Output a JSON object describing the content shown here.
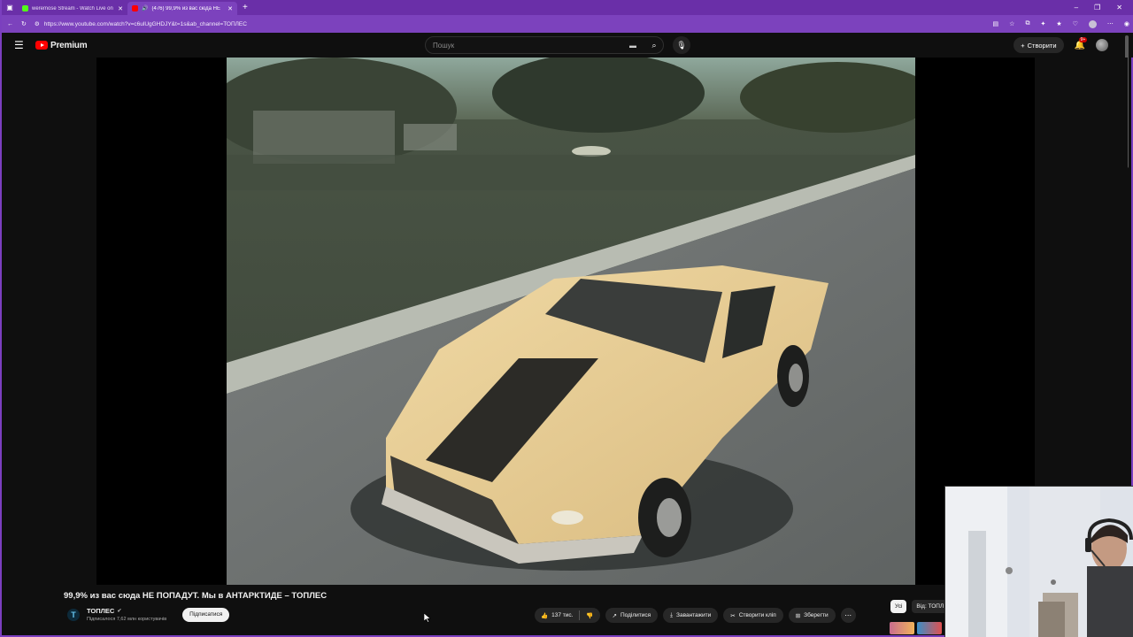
{
  "browser": {
    "tabs": [
      {
        "title": "weremose Stream - Watch Live on",
        "favicon_color": "#53fc18",
        "active": false
      },
      {
        "title": "(476) 99,9% из вас сюда НЕ",
        "favicon_color": "#ff0000",
        "active": true
      }
    ],
    "url": "https://www.youtube.com/watch?v=c6ulUgGHDJY&t=1s&ab_channel=ТОПЛЕС"
  },
  "youtube": {
    "logo_text": "Premium",
    "search_placeholder": "Пошук",
    "create_label": "Створити",
    "notifications_badge": "9+"
  },
  "video": {
    "title": "99,9% из вас сюда НЕ ПОПАДУТ. Мы в АНТАРКТИДЕ – ТОПЛЕС",
    "channel_initial": "T",
    "channel_name": "ТОПЛЕС",
    "subscribers": "Підписалося 7,62 млн користувачів",
    "subscribe_label": "Підписатися",
    "likes": "137 тис.",
    "share_label": "Поділитися",
    "download_label": "Завантажити",
    "clip_label": "Створити кліп",
    "save_label": "Зберегти"
  },
  "recommendations": {
    "chips": [
      "Усі",
      "Від: ТОПЛ"
    ]
  },
  "colors": {
    "browser_chrome": "#7c42bd",
    "yt_red": "#ff0000",
    "background": "#0f0f0f"
  }
}
